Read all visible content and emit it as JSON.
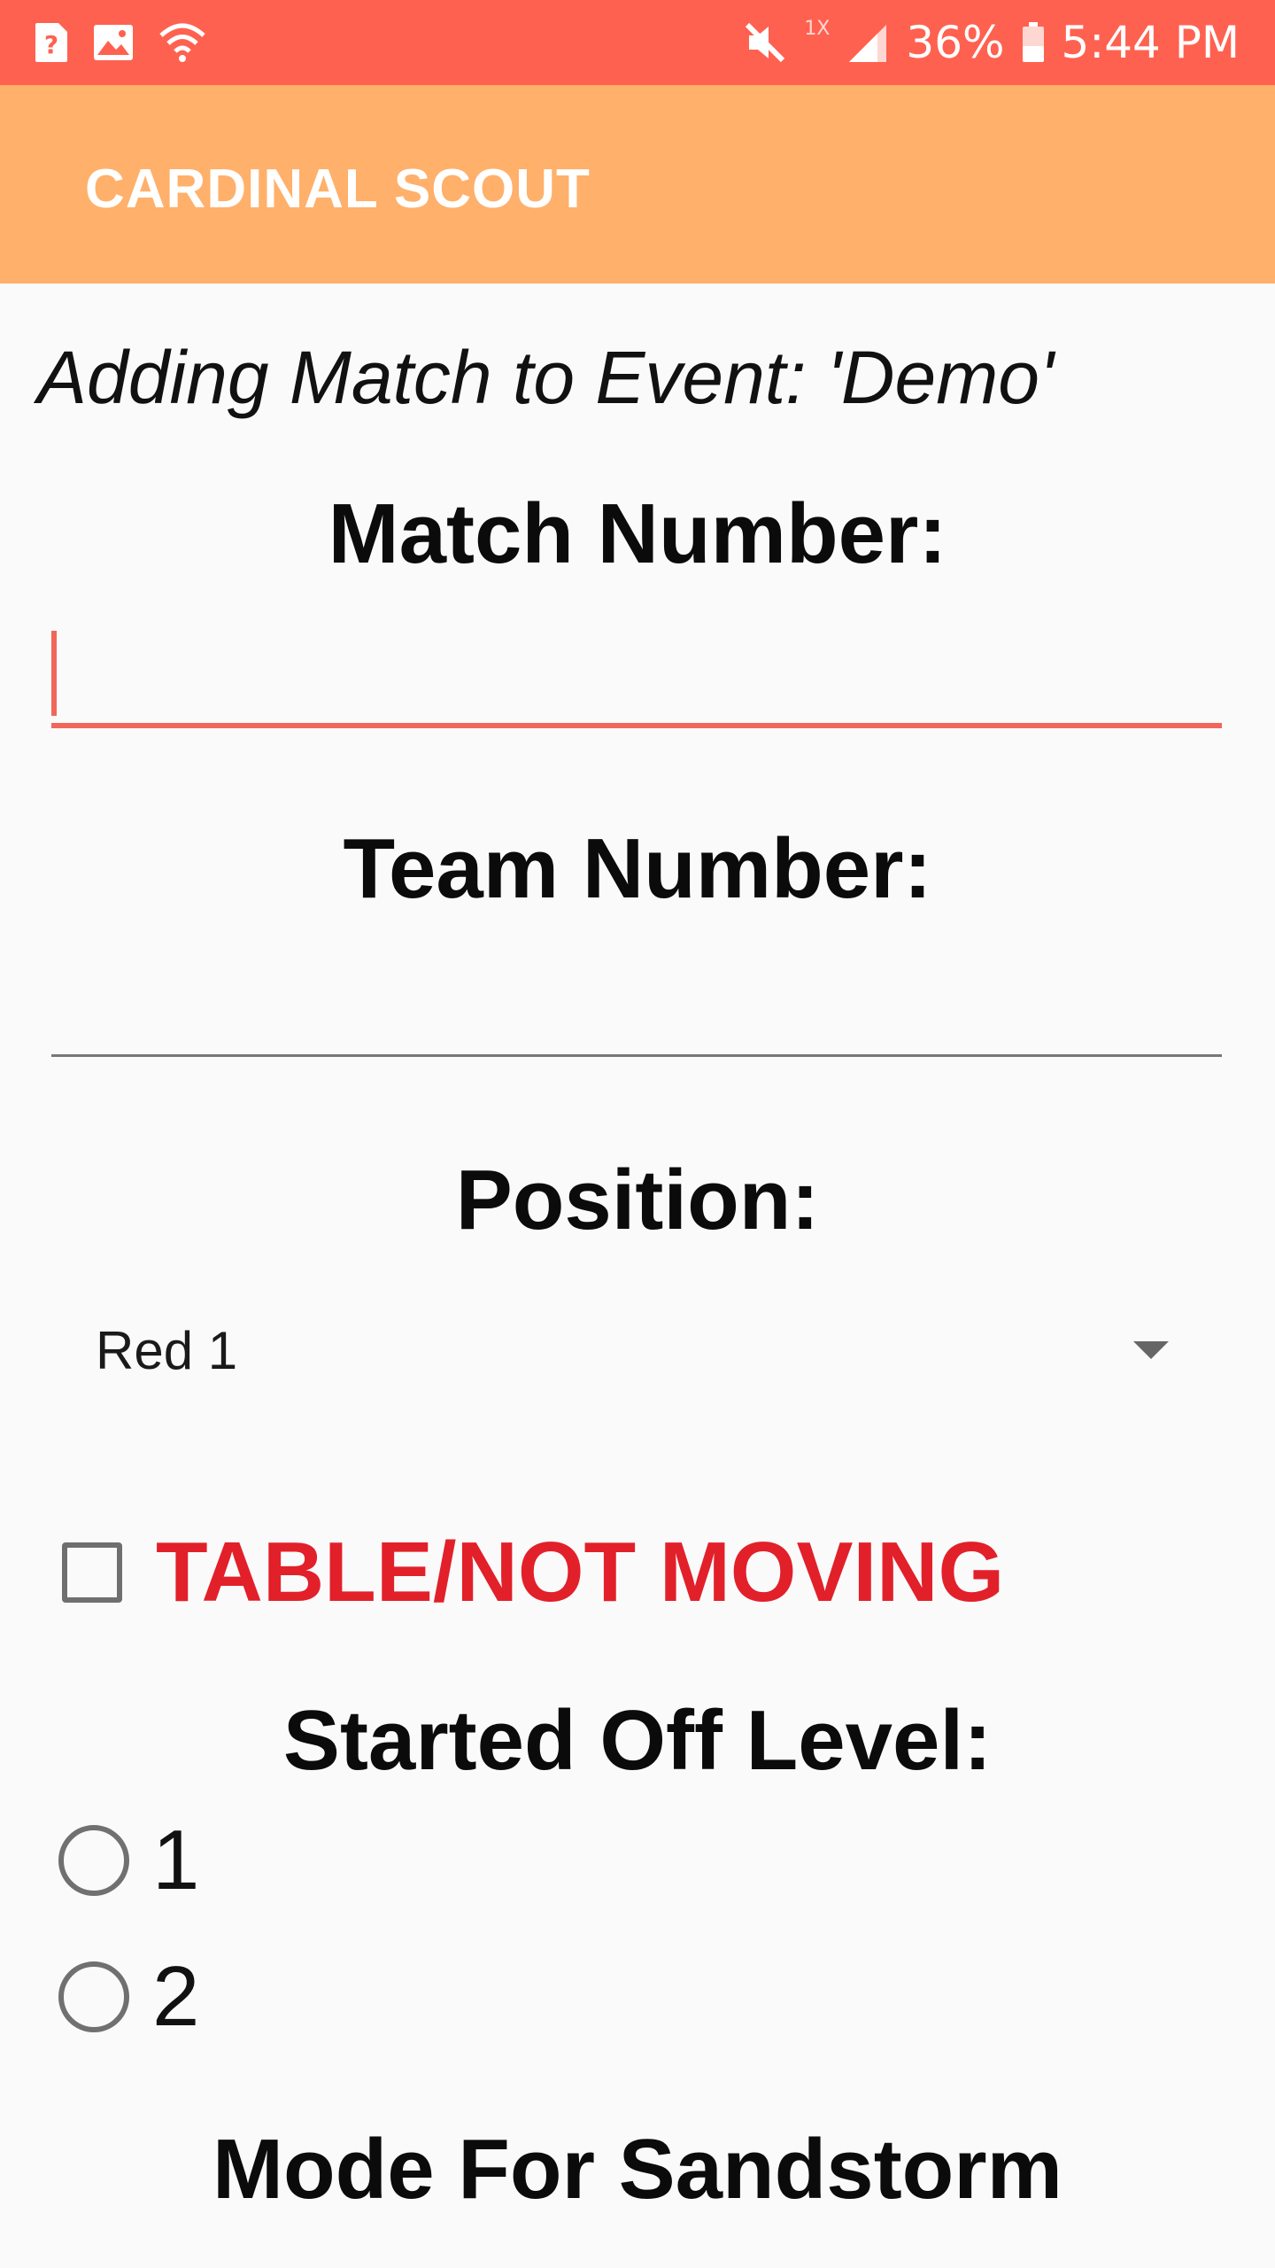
{
  "status_bar": {
    "icons_left": [
      "unknown-notification-icon",
      "image-icon",
      "wifi-icon"
    ],
    "icons_right": [
      "mute-icon",
      "signal-icon",
      "battery-icon"
    ],
    "network_type": "1X",
    "battery": "36%",
    "time": "5:44 PM"
  },
  "app_bar": {
    "title": "CARDINAL SCOUT"
  },
  "form": {
    "subtitle": "Adding Match to Event: 'Demo'",
    "match_number_label": "Match Number:",
    "match_number_value": "",
    "team_number_label": "Team Number:",
    "team_number_value": "",
    "position_label": "Position:",
    "position_value": "Red 1",
    "table_checkbox_label": "TABLE/NOT MOVING",
    "table_checkbox_checked": false,
    "started_level_label": "Started Off Level:",
    "level_options": [
      "1",
      "2"
    ],
    "mode_label": "Mode For Sandstorm"
  },
  "colors": {
    "status_bar": "#ff6150",
    "app_bar": "#ffb06b",
    "accent": "#f0675a",
    "warning_text": "#e2202a",
    "background": "#fafafa"
  }
}
